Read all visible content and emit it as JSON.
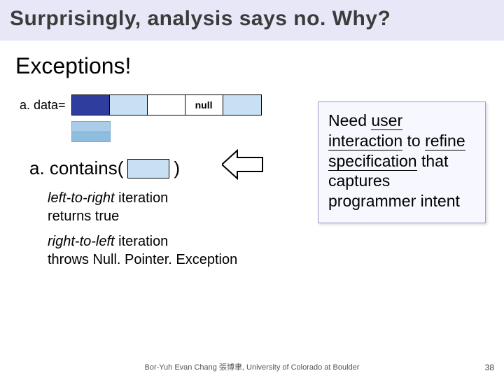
{
  "title": "Surprisingly, analysis says no.  Why?",
  "subheading": "Exceptions!",
  "array": {
    "label": "a. data=",
    "cells": [
      "",
      "",
      "",
      "null",
      ""
    ]
  },
  "call": {
    "prefix": "a. contains(",
    "suffix": ")"
  },
  "bullets": {
    "ltr_ital": "left-to-right ",
    "ltr_rest1": "iteration",
    "ltr_rest2": "returns true",
    "rtl_ital": "right-to-left ",
    "rtl_rest1": "iteration",
    "rtl_rest2": "throws Null. Pointer. Exception"
  },
  "callout": {
    "line1a": "Need ",
    "line1b": "user interaction",
    "line2a": " to ",
    "line2b": "refine specification",
    "line3": " that captures programmer intent"
  },
  "footer": "Bor-Yuh Evan Chang 張博聿, University of Colorado at Boulder",
  "page": "38"
}
